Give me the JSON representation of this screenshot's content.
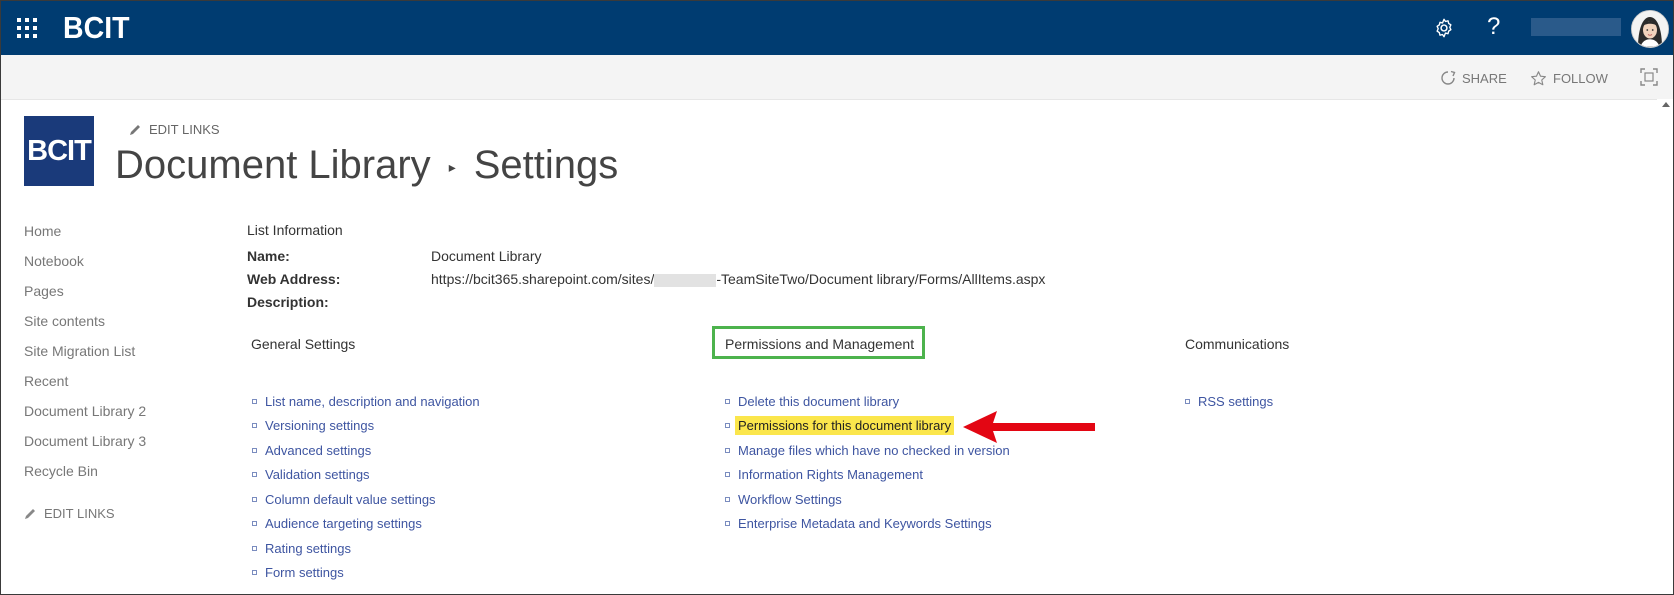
{
  "suitebar": {
    "brand": "BCIT",
    "help_label": "?"
  },
  "actions": {
    "share": "SHARE",
    "follow": "FOLLOW"
  },
  "site": {
    "logo_text": "BCIT",
    "edit_links": "EDIT LINKS",
    "title_part1": "Document Library",
    "title_separator": "▸",
    "title_part2": "Settings"
  },
  "leftnav": {
    "items": [
      {
        "label": "Home"
      },
      {
        "label": "Notebook"
      },
      {
        "label": "Pages"
      },
      {
        "label": "Site contents"
      },
      {
        "label": "Site Migration List"
      },
      {
        "label": "Recent"
      },
      {
        "label": "Document Library 2"
      },
      {
        "label": "Document Library 3"
      },
      {
        "label": "Recycle Bin"
      }
    ],
    "edit_links": "EDIT LINKS"
  },
  "list_info": {
    "heading": "List Information",
    "name_label": "Name:",
    "name_value": "Document Library",
    "web_label": "Web Address:",
    "web_value_prefix": "https://bcit365.sharepoint.com/sites/",
    "web_value_suffix": "-TeamSiteTwo/Document library/Forms/AllItems.aspx",
    "desc_label": "Description:"
  },
  "sections": {
    "general": {
      "heading": "General Settings",
      "links": [
        "List name, description and navigation",
        "Versioning settings",
        "Advanced settings",
        "Validation settings",
        "Column default value settings",
        "Audience targeting settings",
        "Rating settings",
        "Form settings"
      ]
    },
    "permissions": {
      "heading": "Permissions and Management",
      "links": [
        "Delete this document library",
        "Permissions for this document library",
        "Manage files which have no checked in version",
        "Information Rights Management",
        "Workflow Settings",
        "Enterprise Metadata and Keywords Settings"
      ],
      "highlighted_index": 1
    },
    "communications": {
      "heading": "Communications",
      "links": [
        "RSS settings"
      ]
    }
  },
  "colors": {
    "suitebar": "#003c71",
    "link": "#3e55a1",
    "highlight": "#fbe64c",
    "box_green": "#4db34d",
    "arrow_red": "#e30613"
  },
  "icons": {
    "app_launcher": "waffle-icon",
    "settings": "gear-icon",
    "share": "share-icon",
    "follow": "star-icon",
    "focus": "focus-mode-icon",
    "edit": "pencil-icon"
  }
}
